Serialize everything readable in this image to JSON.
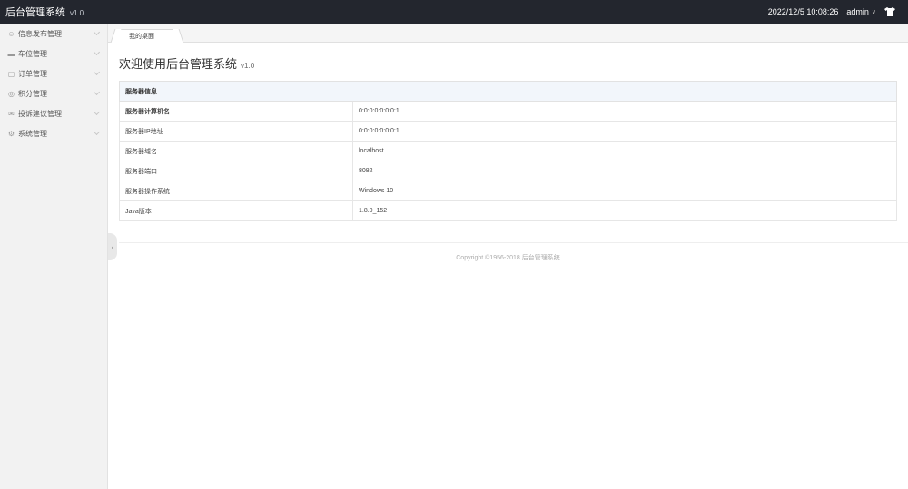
{
  "header": {
    "title": "后台管理系统",
    "version": "v1.0",
    "datetime": "2022/12/5 10:08:26",
    "user": "admin",
    "user_menu_icon": "chevron-down-icon",
    "theme_icon": "shirt-icon"
  },
  "sidebar": {
    "items": [
      {
        "label": "信息发布管理",
        "icon": "info-icon"
      },
      {
        "label": "车位管理",
        "icon": "car-icon"
      },
      {
        "label": "订单管理",
        "icon": "order-icon"
      },
      {
        "label": "积分管理",
        "icon": "points-icon"
      },
      {
        "label": "投诉建议管理",
        "icon": "complaint-icon"
      },
      {
        "label": "系统管理",
        "icon": "settings-icon"
      }
    ]
  },
  "tabs": [
    {
      "label": "我的桌面",
      "active": true
    }
  ],
  "main": {
    "welcome_text": "欢迎使用后台管理系统",
    "welcome_version": "v1.0",
    "table": {
      "header": "服务器信息",
      "rows": [
        {
          "key": "服务器计算机名",
          "value": "0:0:0:0:0:0:0:1"
        },
        {
          "key": "服务器IP地址",
          "value": "0:0:0:0:0:0:0:1"
        },
        {
          "key": "服务器域名",
          "value": "localhost"
        },
        {
          "key": "服务器端口",
          "value": "8082"
        },
        {
          "key": "服务器操作系统",
          "value": "Windows 10"
        },
        {
          "key": "Java版本",
          "value": "1.8.0_152"
        }
      ]
    },
    "footer": "Copyright ©1956-2018 后台管理系统"
  },
  "colors": {
    "topbar": "#23262e",
    "sidebar": "#f2f2f2",
    "table_header": "#f2f6fb"
  }
}
